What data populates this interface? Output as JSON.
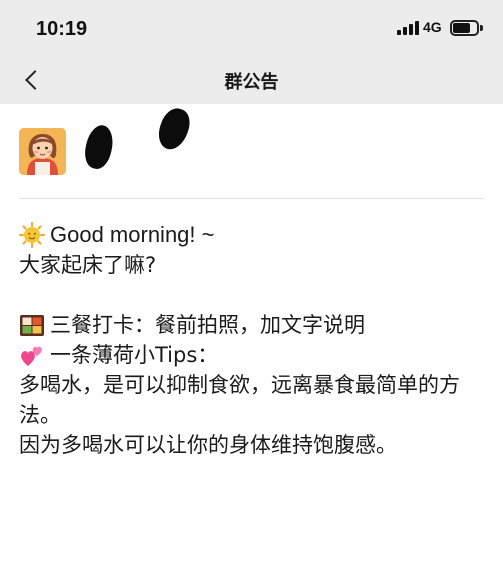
{
  "status_bar": {
    "time": "10:19",
    "network": "4G",
    "battery_level": 0.75
  },
  "nav": {
    "title": "群公告",
    "back_icon": "chevron-left-icon"
  },
  "author": {
    "avatar_icon": "cartoon-girl-avatar"
  },
  "message": {
    "lines": [
      {
        "emoji": "sun-face-emoji",
        "text": "Good morning! ~"
      },
      {
        "emoji": null,
        "text": "大家起床了嘛?"
      },
      {
        "emoji": "bento-box-emoji",
        "text": "三餐打卡：餐前拍照，加文字说明"
      },
      {
        "emoji": "two-hearts-emoji",
        "text": "一条薄荷小Tips："
      },
      {
        "emoji": null,
        "text": "多喝水，是可以抑制食欲，远离暴食最简单的方法。"
      },
      {
        "emoji": null,
        "text": "因为多喝水可以让你的身体维持饱腹感。"
      }
    ]
  },
  "colors": {
    "header_bg": "#ececec",
    "page_bg": "#fefefe",
    "text": "#1b1b1b"
  }
}
